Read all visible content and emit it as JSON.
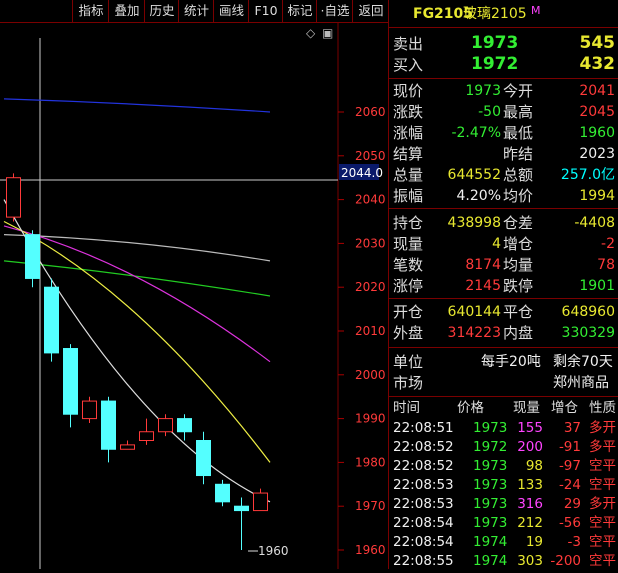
{
  "toolbar": {
    "items": [
      "指标",
      "叠加",
      "历史",
      "统计",
      "画线",
      "F10",
      "标记",
      "·自选",
      "返回"
    ]
  },
  "chart": {
    "controls": [
      "◇",
      "▣"
    ],
    "y_axis_labels": [
      "2060",
      "2050",
      "2040",
      "2030",
      "2020",
      "2010",
      "2000",
      "1990",
      "1980",
      "1970",
      "1960"
    ],
    "crosshair_price": "2044.0",
    "low_annotation": "1960"
  },
  "chart_data": {
    "type": "candlestick",
    "ylim": [
      1956,
      2068
    ],
    "candles": [
      {
        "open": 2036,
        "close": 2045,
        "high": 2046,
        "low": 2035
      },
      {
        "open": 2032,
        "close": 2022,
        "high": 2033,
        "low": 2020
      },
      {
        "open": 2020,
        "close": 2005,
        "high": 2022,
        "low": 2003
      },
      {
        "open": 2006,
        "close": 1991,
        "high": 2007,
        "low": 1988
      },
      {
        "open": 1990,
        "close": 1994,
        "high": 1995,
        "low": 1989
      },
      {
        "open": 1994,
        "close": 1983,
        "high": 1995,
        "low": 1980
      },
      {
        "open": 1983,
        "close": 1984,
        "high": 1985,
        "low": 1983
      },
      {
        "open": 1985,
        "close": 1987,
        "high": 1990,
        "low": 1984
      },
      {
        "open": 1987,
        "close": 1990,
        "high": 1991,
        "low": 1986
      },
      {
        "open": 1990,
        "close": 1987,
        "high": 1991,
        "low": 1985
      },
      {
        "open": 1985,
        "close": 1977,
        "high": 1987,
        "low": 1975
      },
      {
        "open": 1975,
        "close": 1971,
        "high": 1976,
        "low": 1970
      },
      {
        "open": 1970,
        "close": 1969,
        "high": 1972,
        "low": 1960
      },
      {
        "open": 1969,
        "close": 1973,
        "high": 1974,
        "low": 1969
      }
    ],
    "ma_lines": [
      {
        "color": "#2233dd",
        "values": [
          2063,
          2062,
          2060
        ]
      },
      {
        "color": "#bbbbbb",
        "values": [
          2032,
          2031,
          2026
        ]
      },
      {
        "color": "#22cc22",
        "values": [
          2026,
          2023,
          2018
        ]
      },
      {
        "color": "#dd33dd",
        "values": [
          2034,
          2026,
          2003
        ]
      },
      {
        "color": "#eeee44",
        "values": [
          2035,
          2020,
          1980
        ]
      },
      {
        "color": "#dddddd",
        "values": [
          2040,
          1985,
          1971
        ]
      }
    ]
  },
  "quote": {
    "code": "FG2105",
    "name": "玻璃2105",
    "flag": "M",
    "sell_label": "卖出",
    "sell_price": "1973",
    "sell_vol": "545",
    "buy_label": "买入",
    "buy_price": "1972",
    "buy_vol": "432",
    "rows": [
      {
        "l1": "现价",
        "v1": "1973",
        "l2": "今开",
        "v2": "2041"
      },
      {
        "l1": "涨跌",
        "v1": "-50",
        "l2": "最高",
        "v2": "2045"
      },
      {
        "l1": "涨幅",
        "v1": "-2.47%",
        "l2": "最低",
        "v2": "1960"
      },
      {
        "l1": "结算",
        "v1": "",
        "l2": "昨结",
        "v2": "2023"
      },
      {
        "l1": "总量",
        "v1": "644552",
        "l2": "总额",
        "v2": "257.0亿"
      },
      {
        "l1": "振幅",
        "v1": "4.20%",
        "l2": "均价",
        "v2": "1994"
      },
      {
        "l1": "持仓",
        "v1": "438998",
        "l2": "仓差",
        "v2": "-4408"
      },
      {
        "l1": "现量",
        "v1": "4",
        "l2": "增仓",
        "v2": "-2"
      },
      {
        "l1": "笔数",
        "v1": "8174",
        "l2": "均量",
        "v2": "78"
      },
      {
        "l1": "涨停",
        "v1": "2145",
        "l2": "跌停",
        "v2": "1901"
      },
      {
        "l1": "开仓",
        "v1": "640144",
        "l2": "平仓",
        "v2": "648960"
      },
      {
        "l1": "外盘",
        "v1": "314223",
        "l2": "内盘",
        "v2": "330329"
      }
    ],
    "unit_label": "单位",
    "unit_value": "每手20吨",
    "remain_value": "剩余70天",
    "market_label": "市场",
    "market_value": "郑州商品"
  },
  "ticks": {
    "headers": [
      "时间",
      "价格",
      "现量",
      "增仓",
      "性质"
    ],
    "rows": [
      {
        "time": "22:08:51",
        "price": "1973",
        "vol": "155",
        "chg": "37",
        "type": "多开"
      },
      {
        "time": "22:08:52",
        "price": "1972",
        "vol": "200",
        "chg": "-91",
        "type": "多平"
      },
      {
        "time": "22:08:52",
        "price": "1973",
        "vol": "98",
        "chg": "-97",
        "type": "空平"
      },
      {
        "time": "22:08:53",
        "price": "1973",
        "vol": "133",
        "chg": "-24",
        "type": "空平"
      },
      {
        "time": "22:08:53",
        "price": "1973",
        "vol": "316",
        "chg": "29",
        "type": "多开"
      },
      {
        "time": "22:08:54",
        "price": "1973",
        "vol": "212",
        "chg": "-56",
        "type": "空平"
      },
      {
        "time": "22:08:54",
        "price": "1974",
        "vol": "19",
        "chg": "-3",
        "type": "空平"
      },
      {
        "time": "22:08:55",
        "price": "1974",
        "vol": "303",
        "chg": "-200",
        "type": "空平"
      }
    ]
  }
}
